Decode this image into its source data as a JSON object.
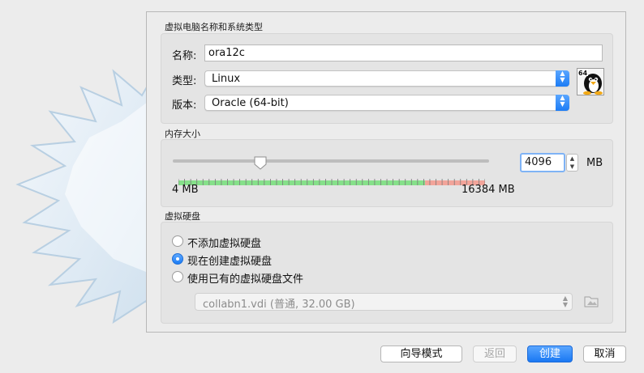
{
  "sections": {
    "name_os": {
      "title": "虚拟电脑名称和系统类型",
      "name_label": "名称:",
      "name_value": "ora12c",
      "type_label": "类型:",
      "type_value": "Linux",
      "version_label": "版本:",
      "version_value": "Oracle (64-bit)",
      "os_badge": "64"
    },
    "memory": {
      "title": "内存大小",
      "value": "4096",
      "unit": "MB",
      "min_label": "4 MB",
      "max_label": "16384 MB",
      "min_mb": 4,
      "max_mb": 16384
    },
    "disk": {
      "title": "虚拟硬盘",
      "options": [
        "不添加虚拟硬盘",
        "现在创建虚拟硬盘",
        "使用已有的虚拟硬盘文件"
      ],
      "selected_index": 1,
      "existing_file": "collabn1.vdi (普通, 32.00 GB)"
    }
  },
  "buttons": {
    "guided": "向导模式",
    "back": "返回",
    "create": "创建",
    "cancel": "取消"
  },
  "colors": {
    "accent": "#1c7cf5",
    "scale_green": "#86e08a",
    "scale_red": "#f2a49a"
  },
  "icons": {
    "os": "linux-tux-icon",
    "folder": "folder-icon",
    "background": "virtualbox-star-logo"
  }
}
